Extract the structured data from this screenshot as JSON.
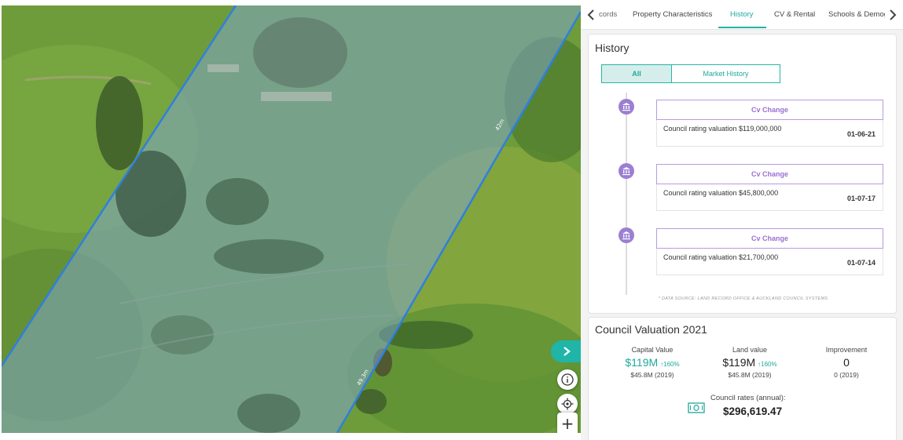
{
  "map": {
    "boundary_labels": [
      "42m",
      "49.3m"
    ],
    "controls": [
      "chevron-right-icon",
      "info-icon",
      "locate-icon",
      "zoom-in-icon"
    ],
    "zoom_in_label": "+",
    "boundary_color": "#2f7fe0",
    "parcel_tint": "#7fa6c8"
  },
  "tabs": {
    "items": [
      "cords",
      "Property Characteristics",
      "History",
      "CV & Rental",
      "Schools & Demog"
    ],
    "active": "History",
    "accent": "#1fb5a8"
  },
  "history": {
    "title": "History",
    "filters": {
      "all_label": "All",
      "market_label": "Market History",
      "selected": "All"
    },
    "events": [
      {
        "type": "Cv Change",
        "description": "Council rating valuation $119,000,000",
        "date": "01-06-21"
      },
      {
        "type": "Cv Change",
        "description": "Council rating valuation $45,800,000",
        "date": "01-07-17"
      },
      {
        "type": "Cv Change",
        "description": "Council rating valuation $21,700,000",
        "date": "01-07-14"
      }
    ],
    "event_color": "#9b7fd2",
    "source_note": "* DATA SOURCE: LAND RECORD OFFICE & AUCKLAND COUNCIL SYSTEMS"
  },
  "valuation": {
    "title": "Council Valuation 2021",
    "capital": {
      "label": "Capital Value",
      "value": "$119M",
      "change": "↑160%",
      "previous": "$45.8M (2019)"
    },
    "land": {
      "label": "Land value",
      "value": "$119M",
      "change": "↑160%",
      "previous": "$45.8M (2019)"
    },
    "improvement": {
      "label": "Improvement",
      "value": "0",
      "previous": "0 (2019)"
    },
    "rates": {
      "label": "Council rates (annual):",
      "value": "$296,619.47",
      "icon": "cash-icon"
    }
  }
}
